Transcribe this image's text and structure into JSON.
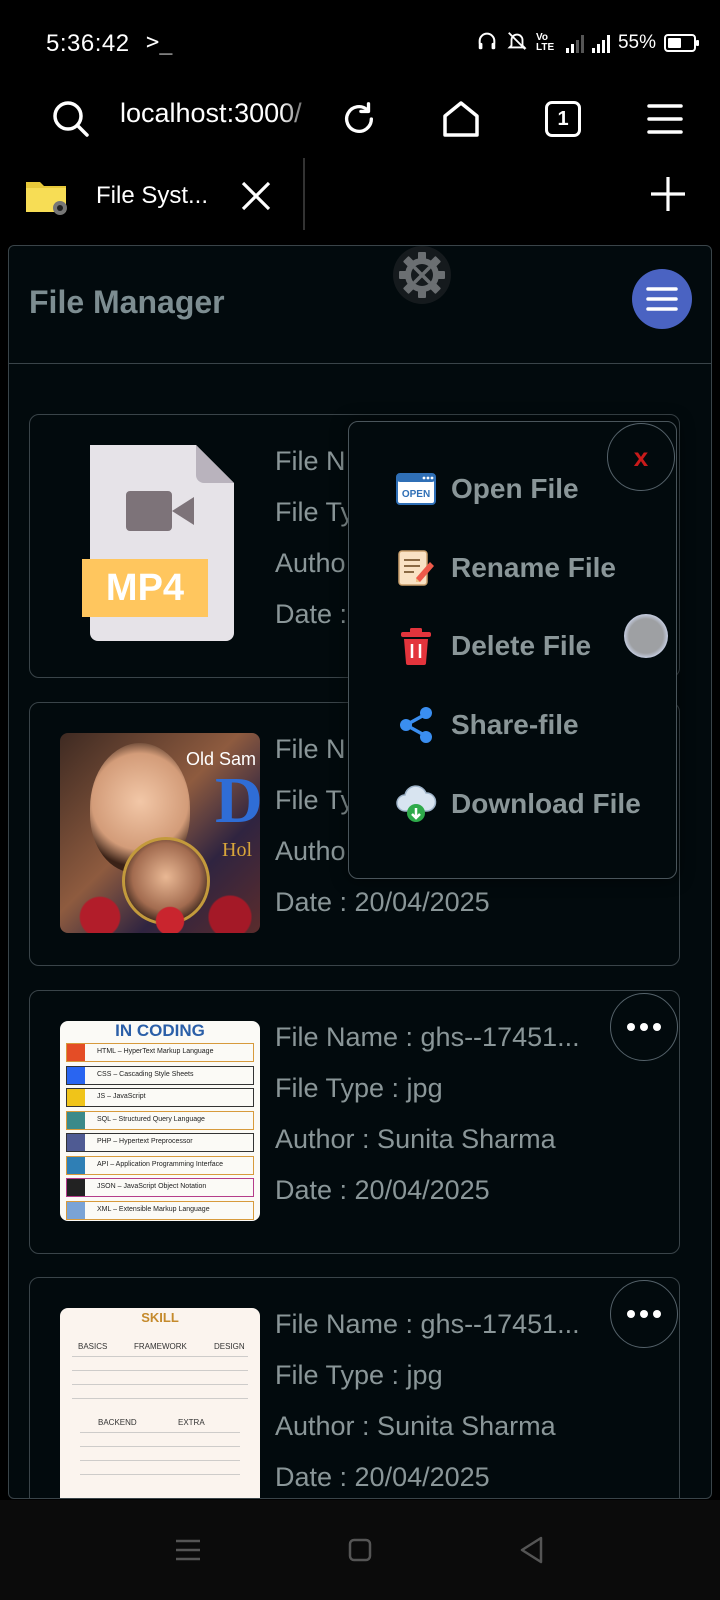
{
  "status_bar": {
    "time": "5:36:42",
    "terminal_glyph": ">_",
    "volte": "Vo LTE",
    "battery_percent": "55%",
    "battery_level": 0.55
  },
  "browser": {
    "url": "localhost:3000/",
    "tab_count": "1",
    "tab_title": "File Syst..."
  },
  "app": {
    "title": "File Manager"
  },
  "files": [
    {
      "thumb": "mp4-file-icon",
      "thumb_label": "MP4",
      "name_label": "File N",
      "type_label": "File Ty",
      "author_label": "Autho",
      "date_label": "Date :"
    },
    {
      "thumb": "photo-thumbnail",
      "thumb_text": "Old Sam",
      "thumb_letter": "D",
      "thumb_small": "Hol",
      "name_label": "File N",
      "type_label": "File Ty",
      "author_label": "Autho",
      "date": "Date : 20/04/2025"
    },
    {
      "thumb": "coding-thumbnail",
      "thumb_heading": "IN CODING",
      "thumb_rows": [
        "HTML – HyperText Markup Language",
        "CSS – Cascading Style Sheets",
        "JS – JavaScript",
        "SQL – Structured Query Language",
        "PHP – Hypertext Preprocessor",
        "API – Application Programming Interface",
        "JSON – JavaScript Object Notation",
        "XML – Extensible Markup Language"
      ],
      "name": "File Name : ghs--17451...",
      "type": "File Type : jpg",
      "author": "Author : Sunita Sharma",
      "date": "Date : 20/04/2025"
    },
    {
      "thumb": "skill-thumbnail",
      "thumb_heading": "SKILL",
      "thumb_cols": [
        "BASICS",
        "FRAMEWORK",
        "DESIGN"
      ],
      "thumb_cols2": [
        "BACKEND",
        "EXTRA"
      ],
      "name": "File Name : ghs--17451...",
      "type": "File Type : jpg",
      "author": "Author : Sunita Sharma",
      "date": "Date : 20/04/2025"
    }
  ],
  "context_menu": {
    "close_label": "x",
    "open_badge": "OPEN",
    "items": [
      {
        "label": "Open File",
        "icon": "open-file-icon"
      },
      {
        "label": "Rename File",
        "icon": "rename-file-icon"
      },
      {
        "label": "Delete File",
        "icon": "delete-file-icon"
      },
      {
        "label": "Share-file",
        "icon": "share-file-icon"
      },
      {
        "label": "Download File",
        "icon": "download-file-icon"
      }
    ]
  },
  "colors": {
    "menu_button": "#4a63c2",
    "close_x": "#c81a1a",
    "muted_text": "#8a9698",
    "card_border": "#3a4449"
  }
}
